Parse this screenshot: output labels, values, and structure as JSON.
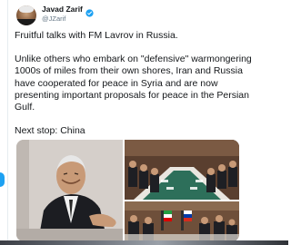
{
  "tweet": {
    "author": {
      "display_name": "Javad Zarif",
      "handle": "@JZarif",
      "verified": true
    },
    "paragraphs": [
      "Fruitful talks with FM Lavrov in Russia.",
      "Unlike others who embark on \"defensive\" warmongering\n1000s of miles from their own shores, Iran and Russia\nhave cooperated for peace in Syria and are now\npresenting important proposals for peace in the Persian\nGulf.",
      "Next stop: China"
    ],
    "media": {
      "count": 3
    }
  },
  "colors": {
    "text": "#14171a",
    "secondary_text": "#657786",
    "verified": "#1da1f2",
    "accent": "#1da1f2"
  },
  "icons": {
    "verified": "verified-badge-icon"
  }
}
